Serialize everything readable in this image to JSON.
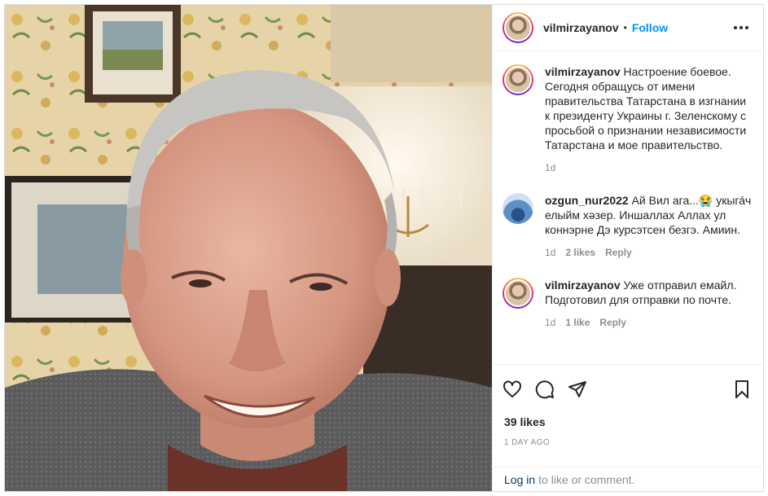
{
  "post": {
    "author": "vilmirzayanov",
    "separator": "•",
    "follow_label": "Follow"
  },
  "comments": [
    {
      "user": "vilmirzayanov",
      "text": "Настроение боевое. Сегодня обращусь от имени правительства Татарстана в изгнании к президенту Украины г. Зеленскому с просьбой о признании независимости Татарстана и мое правительство.",
      "time": "1d"
    },
    {
      "user": "ozgun_nur2022",
      "text": "Ай Вил ага...😭 укыга́ч елыйм хәзер. Иншаллах Аллах ул коннэрне Дэ курсэтсен безгэ. Амиин.",
      "time": "1d",
      "likes": "2 likes",
      "reply": "Reply"
    },
    {
      "user": "vilmirzayanov",
      "text": "Уже отправил емайл. Подготовил для отправки по почте.",
      "time": "1d",
      "likes": "1 like",
      "reply": "Reply"
    }
  ],
  "stats": {
    "likes": "39 likes",
    "date": "1 DAY AGO"
  },
  "login": {
    "link": "Log in",
    "rest": "to like or comment."
  },
  "icons": {
    "like": "heart-icon",
    "comment": "comment-icon",
    "share": "paper-plane-icon",
    "save": "bookmark-icon",
    "more": "more-options-icon"
  },
  "colors": {
    "accent": "#0095f6",
    "text": "#262626",
    "muted": "#8e8e8e",
    "link": "#00376b"
  }
}
